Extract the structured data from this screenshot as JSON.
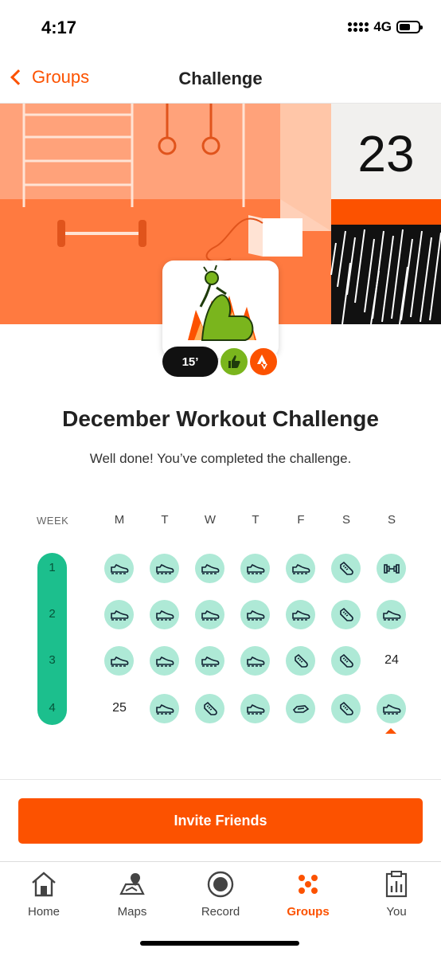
{
  "status": {
    "time": "4:17",
    "network": "4G"
  },
  "nav": {
    "back_label": "Groups",
    "title": "Challenge"
  },
  "hero": {
    "calendar_day": "23"
  },
  "badge": {
    "minutes": "15’"
  },
  "challenge": {
    "title": "December Workout Challenge",
    "subtitle": "Well done! You’ve completed the challenge."
  },
  "calendar": {
    "week_label": "WEEK",
    "days": [
      "M",
      "T",
      "W",
      "T",
      "F",
      "S",
      "S"
    ],
    "weeks": [
      {
        "number": "1",
        "cells": [
          {
            "kind": "icon",
            "icon": "shoe-icon"
          },
          {
            "kind": "icon",
            "icon": "shoe-icon"
          },
          {
            "kind": "icon",
            "icon": "shoe-icon"
          },
          {
            "kind": "icon",
            "icon": "shoe-icon"
          },
          {
            "kind": "icon",
            "icon": "shoe-icon"
          },
          {
            "kind": "icon",
            "icon": "sneaker-icon"
          },
          {
            "kind": "icon",
            "icon": "dumbbell-icon"
          }
        ]
      },
      {
        "number": "2",
        "cells": [
          {
            "kind": "icon",
            "icon": "shoe-icon"
          },
          {
            "kind": "icon",
            "icon": "shoe-icon"
          },
          {
            "kind": "icon",
            "icon": "shoe-icon"
          },
          {
            "kind": "icon",
            "icon": "shoe-icon"
          },
          {
            "kind": "icon",
            "icon": "shoe-icon"
          },
          {
            "kind": "icon",
            "icon": "sneaker-icon"
          },
          {
            "kind": "icon",
            "icon": "shoe-icon"
          }
        ]
      },
      {
        "number": "3",
        "cells": [
          {
            "kind": "icon",
            "icon": "shoe-icon"
          },
          {
            "kind": "icon",
            "icon": "shoe-icon"
          },
          {
            "kind": "icon",
            "icon": "shoe-icon"
          },
          {
            "kind": "icon",
            "icon": "shoe-icon"
          },
          {
            "kind": "icon",
            "icon": "sneaker-icon"
          },
          {
            "kind": "icon",
            "icon": "sneaker-icon"
          },
          {
            "kind": "date",
            "text": "24"
          }
        ]
      },
      {
        "number": "4",
        "cells": [
          {
            "kind": "date",
            "text": "25"
          },
          {
            "kind": "icon",
            "icon": "shoe-icon"
          },
          {
            "kind": "icon",
            "icon": "sneaker-icon"
          },
          {
            "kind": "icon",
            "icon": "shoe-icon"
          },
          {
            "kind": "icon",
            "icon": "skate-icon"
          },
          {
            "kind": "icon",
            "icon": "sneaker-icon"
          },
          {
            "kind": "icon",
            "icon": "shoe-icon",
            "today": true
          }
        ]
      }
    ]
  },
  "invite_label": "Invite Friends",
  "tabs": [
    {
      "label": "Home",
      "icon": "home-icon",
      "active": false
    },
    {
      "label": "Maps",
      "icon": "map-icon",
      "active": false
    },
    {
      "label": "Record",
      "icon": "record-icon",
      "active": false
    },
    {
      "label": "Groups",
      "icon": "groups-icon",
      "active": true
    },
    {
      "label": "You",
      "icon": "profile-icon",
      "active": false
    }
  ],
  "colors": {
    "accent": "#fc5200",
    "week_bar": "#1cbf8d",
    "activity_bubble": "#aee9d6",
    "badge_green": "#7ab51d"
  }
}
